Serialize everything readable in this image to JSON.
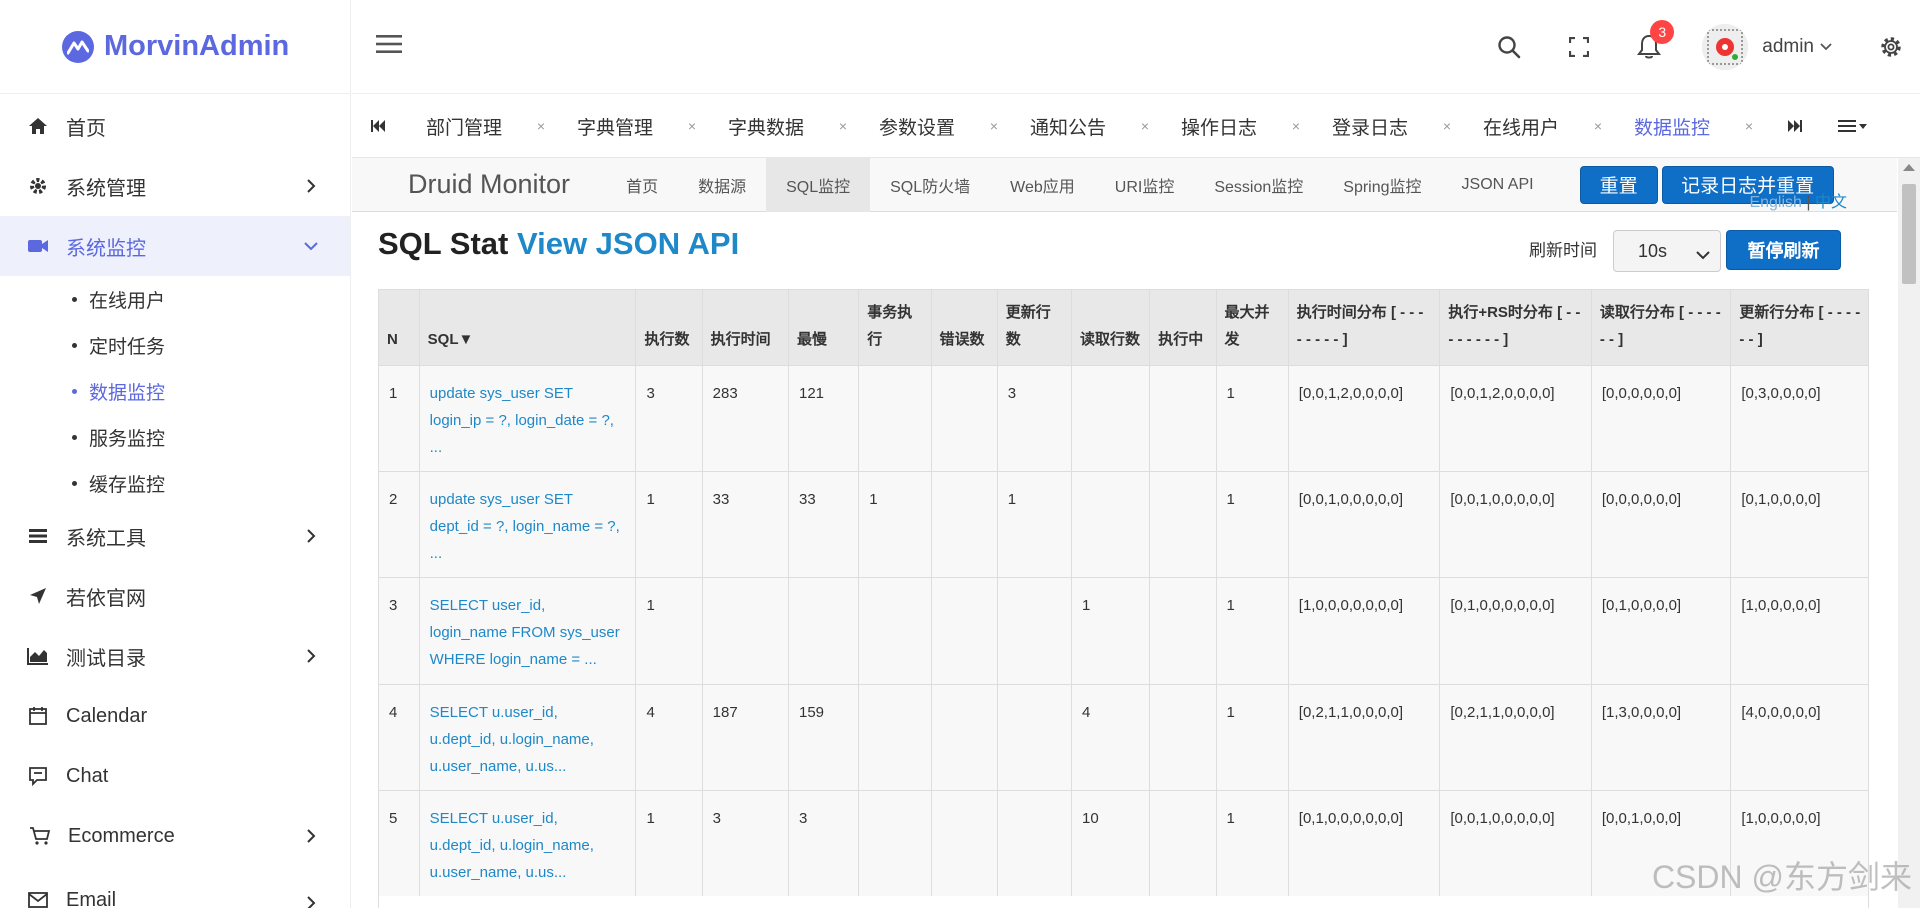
{
  "brand": {
    "name": "MorvinAdmin",
    "color": "#5b68e0"
  },
  "sidebar": {
    "items": [
      {
        "label": "首页",
        "icon": "home-icon"
      },
      {
        "label": "系统管理",
        "icon": "gear-icon"
      },
      {
        "label": "系统监控",
        "icon": "video-icon"
      },
      {
        "label": "系统工具",
        "icon": "list-icon"
      },
      {
        "label": "若依官网",
        "icon": "send-icon"
      },
      {
        "label": "测试目录",
        "icon": "area-chart-icon"
      },
      {
        "label": "Calendar",
        "icon": "calendar-icon"
      },
      {
        "label": "Chat",
        "icon": "chat-icon"
      },
      {
        "label": "Ecommerce",
        "icon": "cart-icon"
      },
      {
        "label": "Email",
        "icon": "mail-icon"
      }
    ],
    "submenu": [
      {
        "label": "在线用户"
      },
      {
        "label": "定时任务"
      },
      {
        "label": "数据监控"
      },
      {
        "label": "服务监控"
      },
      {
        "label": "缓存监控"
      }
    ]
  },
  "topbar": {
    "username": "admin",
    "notification_count": "3"
  },
  "tabs": [
    {
      "label": "部门管理"
    },
    {
      "label": "字典管理"
    },
    {
      "label": "字典数据"
    },
    {
      "label": "参数设置"
    },
    {
      "label": "通知公告"
    },
    {
      "label": "操作日志"
    },
    {
      "label": "登录日志"
    },
    {
      "label": "在线用户"
    },
    {
      "label": "数据监控"
    }
  ],
  "tab_close": "×",
  "druid": {
    "brand": "Druid Monitor",
    "nav": [
      "首页",
      "数据源",
      "SQL监控",
      "SQL防火墙",
      "Web应用",
      "URI监控",
      "Session监控",
      "Spring监控",
      "JSON API"
    ],
    "reset_label": "重置",
    "log_reset_label": "记录日志并重置",
    "lang_en": "English",
    "lang_sep": " | ",
    "lang_zh": "中文",
    "title_main": "SQL Stat ",
    "title_link": "View JSON API",
    "refresh_label": "刷新时间",
    "refresh_value": "10s",
    "pause_label": "暂停刷新"
  },
  "table": {
    "headers": [
      "N",
      "SQL▼",
      "执行数",
      "执行时间",
      "最慢",
      "事务执行",
      "错误数",
      "更新行数",
      "读取行数",
      "执行中",
      "最大并发",
      "执行时间分布 [ - - - - - - - - ]",
      "执行+RS时分布 [ - - - - - - - - ]",
      "读取行分布 [ - - - - - - ]",
      "更新行分布 [ - - - - - - ]"
    ],
    "rows": [
      [
        "1",
        "update sys_user SET login_ip = ?, login_date = ?, ...",
        "3",
        "283",
        "121",
        "",
        "",
        "3",
        "",
        "",
        "1",
        "[0,0,1,2,0,0,0,0]",
        "[0,0,1,2,0,0,0,0]",
        "[0,0,0,0,0,0]",
        "[0,3,0,0,0,0]"
      ],
      [
        "2",
        "update sys_user SET dept_id = ?, login_name = ?, ...",
        "1",
        "33",
        "33",
        "1",
        "",
        "1",
        "",
        "",
        "1",
        "[0,0,1,0,0,0,0,0]",
        "[0,0,1,0,0,0,0,0]",
        "[0,0,0,0,0,0]",
        "[0,1,0,0,0,0]"
      ],
      [
        "3",
        "SELECT user_id, login_name FROM sys_user WHERE login_name = ...",
        "1",
        "",
        "",
        "",
        "",
        "",
        "1",
        "",
        "1",
        "[1,0,0,0,0,0,0,0]",
        "[0,1,0,0,0,0,0,0]",
        "[0,1,0,0,0,0]",
        "[1,0,0,0,0,0]"
      ],
      [
        "4",
        "SELECT u.user_id, u.dept_id, u.login_name, u.user_name, u.us...",
        "4",
        "187",
        "159",
        "",
        "",
        "",
        "4",
        "",
        "1",
        "[0,2,1,1,0,0,0,0]",
        "[0,2,1,1,0,0,0,0]",
        "[1,3,0,0,0,0]",
        "[4,0,0,0,0,0]"
      ],
      [
        "5",
        "SELECT u.user_id, u.dept_id, u.login_name, u.user_name, u.us...",
        "1",
        "3",
        "3",
        "",
        "",
        "",
        "10",
        "",
        "1",
        "[0,1,0,0,0,0,0,0]",
        "[0,0,1,0,0,0,0,0]",
        "[0,0,1,0,0,0]",
        "[1,0,0,0,0,0]"
      ]
    ]
  },
  "watermark": "CSDN @东方剑来"
}
